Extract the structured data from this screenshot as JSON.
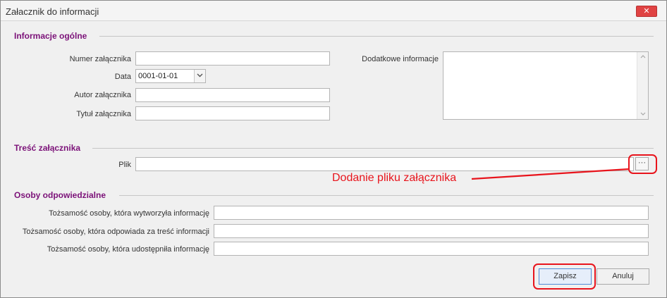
{
  "window": {
    "title": "Załacznik do informacji",
    "close_glyph": "✕"
  },
  "general": {
    "section_title": "Informacje ogólne",
    "number_label": "Numer załącznika",
    "number_value": "",
    "date_label": "Data",
    "date_value": "0001-01-01",
    "author_label": "Autor załącznika",
    "author_value": "",
    "title_label": "Tytuł załącznika",
    "title_value": "",
    "additional_label": "Dodatkowe informacje",
    "additional_value": ""
  },
  "content": {
    "section_title": "Treść załącznika",
    "file_label": "Plik",
    "file_value": "",
    "browse_label": "···"
  },
  "annotation": {
    "text": "Dodanie pliku załącznika",
    "color": "#e8141c"
  },
  "persons": {
    "section_title": "Osoby odpowiedzialne",
    "created_label": "Tożsamość osoby, która wytworzyła informację",
    "created_value": "",
    "responsible_label": "Tożsamość osoby, która odpowiada za treść informacji",
    "responsible_value": "",
    "shared_label": "Tożsamość osoby, która udostępniła informację",
    "shared_value": ""
  },
  "buttons": {
    "save_label": "Zapisz",
    "cancel_label": "Anuluj"
  },
  "colors": {
    "section_title": "#7b1178",
    "close_button": "#e04343",
    "primary_border": "#4f8ad6"
  },
  "icons": {
    "date_dropdown": "chevron-down-icon",
    "scroll_up": "chevron-up-icon",
    "scroll_down": "chevron-down-icon",
    "close": "close-icon"
  }
}
